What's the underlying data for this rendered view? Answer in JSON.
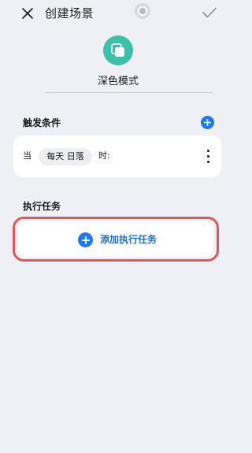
{
  "header": {
    "title": "创建场景",
    "close_icon": "close-icon",
    "confirm_icon": "check-icon"
  },
  "scene": {
    "icon": "copy-square-icon",
    "name": "深色模式"
  },
  "conditions": {
    "label": "触发条件",
    "add_icon": "plus-circle-icon",
    "item": {
      "prefix": "当",
      "chip": "每天 日落",
      "suffix": "时:",
      "more_icon": "more-vertical-icon"
    }
  },
  "tasks": {
    "label": "执行任务",
    "add_label": "添加执行任务",
    "add_icon": "plus-circle-icon"
  },
  "colors": {
    "background": "#eef0f6",
    "accent_blue": "#1f7af2",
    "scene_teal": "#3ebfa9",
    "highlight_red": "#e05a55"
  }
}
